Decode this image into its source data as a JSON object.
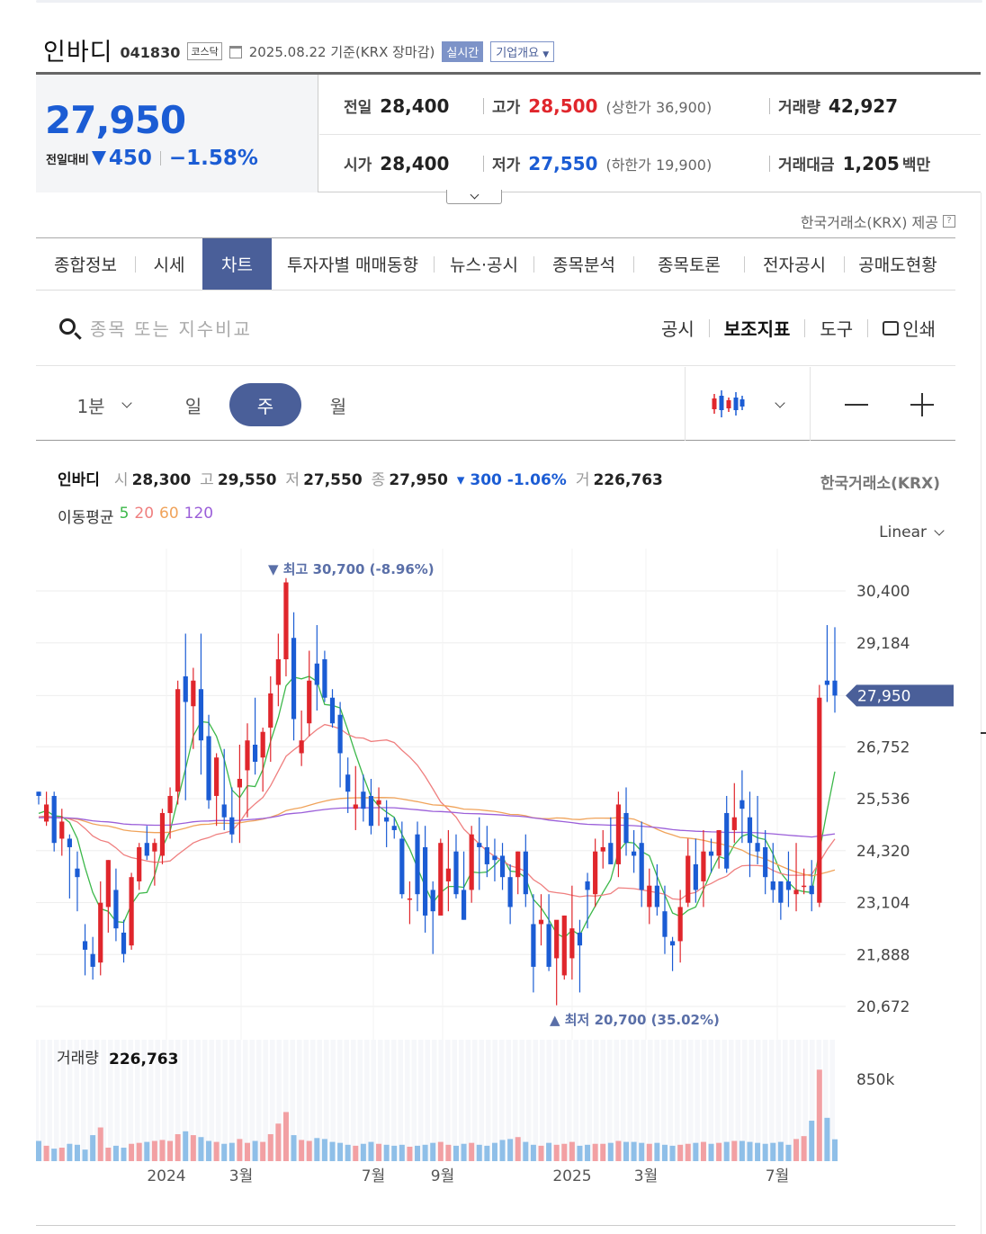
{
  "header": {
    "stock_name": "인바디",
    "stock_code": "041830",
    "market_badge": "코스닥",
    "date_text": "2025.08.22 기준(KRX 장마감)",
    "realtime_badge": "실시간",
    "company_btn": "기업개요"
  },
  "quote": {
    "price": "27,950",
    "change_label": "전일대비",
    "change_value": "450",
    "change_pct": "−1.58%",
    "prev_label": "전일",
    "prev_value": "28,400",
    "high_label": "고가",
    "high_value": "28,500",
    "upper_limit": "(상한가 36,900)",
    "volume_label": "거래량",
    "volume_value": "42,927",
    "open_label": "시가",
    "open_value": "28,400",
    "low_label": "저가",
    "low_value": "27,550",
    "lower_limit": "(하한가 19,900)",
    "amount_label": "거래대금",
    "amount_value": "1,205",
    "amount_unit": "백만"
  },
  "provider_note": "한국거래소(KRX) 제공",
  "tabs": [
    "종합정보",
    "시세",
    "차트",
    "투자자별 매매동향",
    "뉴스·공시",
    "종목분석",
    "종목토론",
    "전자공시",
    "공매도현황"
  ],
  "search": {
    "placeholder": "종목 또는 지수비교"
  },
  "tools": {
    "notice": "공시",
    "indicator": "보조지표",
    "tool": "도구",
    "print": "인쇄"
  },
  "periods": {
    "minute": "1분",
    "day": "일",
    "week": "주",
    "month": "월"
  },
  "chart_info": {
    "name": "인바디",
    "open_k": "시",
    "open_v": "28,300",
    "high_k": "고",
    "high_v": "29,550",
    "low_k": "저",
    "low_v": "27,550",
    "close_k": "종",
    "close_v": "27,950",
    "change": "▾ 300 -1.06%",
    "vol_k": "거",
    "vol_v": "226,763",
    "exchange": "한국거래소(KRX)",
    "ma_label": "이동평균",
    "ma_5": "5",
    "ma_20": "20",
    "ma_60": "60",
    "ma_120": "120",
    "scale": "Linear"
  },
  "colors": {
    "up": "#e0262c",
    "down": "#1b5cd4",
    "accent": "#4a5f99",
    "ma5": "#3cb84a",
    "ma20": "#ef7f7f",
    "ma60": "#f0a35a",
    "ma120": "#9b5fd9"
  },
  "chart_data": {
    "type": "candlestick",
    "timeframe": "weekly",
    "y_ticks": [
      "30,400",
      "29,184",
      "27,950",
      "26,752",
      "25,536",
      "24,320",
      "23,104",
      "21,888",
      "20,672"
    ],
    "ylim": [
      20672,
      30400
    ],
    "x_ticks": [
      "2024",
      "3월",
      "7월",
      "9월",
      "2025",
      "3월",
      "7월"
    ],
    "current_price": "27,950",
    "max_annotation": "▼ 최고 30,700 (-8.96%)",
    "min_annotation": "▲ 최저 20,700 (35.02%)",
    "volume_label": "거래량",
    "volume_value": "226,763",
    "volume_tick": "850k",
    "candles": [
      [
        25700,
        25700,
        25400,
        25600
      ],
      [
        25000,
        25700,
        24900,
        25400
      ],
      [
        25600,
        25700,
        24300,
        24500
      ],
      [
        24600,
        25300,
        24200,
        25000
      ],
      [
        24600,
        24700,
        23200,
        24400
      ],
      [
        23900,
        24300,
        22900,
        23700
      ],
      [
        22200,
        22600,
        21400,
        22000
      ],
      [
        21900,
        22300,
        21300,
        21600
      ],
      [
        21700,
        23600,
        21400,
        23100
      ],
      [
        23000,
        24100,
        22400,
        24100
      ],
      [
        23400,
        23900,
        22200,
        22500
      ],
      [
        22400,
        22700,
        21700,
        21900
      ],
      [
        22100,
        23800,
        22000,
        23700
      ],
      [
        23600,
        24500,
        23400,
        24400
      ],
      [
        24500,
        24900,
        24100,
        24200
      ],
      [
        24300,
        24600,
        23500,
        24500
      ],
      [
        24200,
        25300,
        24000,
        25200
      ],
      [
        25200,
        25800,
        24600,
        25600
      ],
      [
        25700,
        28300,
        25400,
        28100
      ],
      [
        28400,
        29400,
        25500,
        27800
      ],
      [
        27700,
        28600,
        26700,
        28300
      ],
      [
        28100,
        29400,
        26100,
        26900
      ],
      [
        27000,
        27500,
        25300,
        25500
      ],
      [
        25600,
        26600,
        24900,
        26500
      ],
      [
        25400,
        26700,
        24800,
        25100
      ],
      [
        25100,
        25800,
        24500,
        24700
      ],
      [
        25800,
        26800,
        24500,
        26000
      ],
      [
        26200,
        27300,
        25100,
        26900
      ],
      [
        26800,
        27900,
        26100,
        26400
      ],
      [
        26500,
        27200,
        25700,
        27100
      ],
      [
        27200,
        28400,
        26400,
        28000
      ],
      [
        28200,
        29400,
        27700,
        28800
      ],
      [
        28800,
        30700,
        28400,
        30600
      ],
      [
        29300,
        29900,
        26900,
        27400
      ],
      [
        26600,
        27600,
        26300,
        26900
      ],
      [
        27300,
        29000,
        27000,
        28300
      ],
      [
        28700,
        29600,
        27600,
        28200
      ],
      [
        28800,
        29000,
        27800,
        27900
      ],
      [
        27900,
        28100,
        27200,
        27300
      ],
      [
        27500,
        27800,
        25800,
        26600
      ],
      [
        26100,
        26500,
        25200,
        25700
      ],
      [
        25300,
        26300,
        24800,
        25400
      ],
      [
        25700,
        26100,
        25000,
        25300
      ],
      [
        25600,
        26000,
        24700,
        24900
      ],
      [
        25400,
        25800,
        24900,
        25500
      ],
      [
        25100,
        25500,
        24400,
        25000
      ],
      [
        24900,
        25100,
        24600,
        24800
      ],
      [
        24600,
        25000,
        23200,
        23300
      ],
      [
        23200,
        23600,
        22600,
        23200
      ],
      [
        24700,
        25000,
        22900,
        23300
      ],
      [
        24400,
        24900,
        22400,
        22800
      ],
      [
        23400,
        23600,
        21900,
        22900
      ],
      [
        22800,
        24600,
        23000,
        24500
      ],
      [
        23600,
        24800,
        22900,
        23900
      ],
      [
        24300,
        24700,
        23200,
        23300
      ],
      [
        23400,
        24300,
        22700,
        22700
      ],
      [
        23400,
        24900,
        23100,
        24700
      ],
      [
        24500,
        25100,
        23400,
        24400
      ],
      [
        24400,
        24900,
        23700,
        24000
      ],
      [
        24200,
        24600,
        23600,
        24100
      ],
      [
        24200,
        24500,
        23400,
        23700
      ],
      [
        23700,
        24000,
        22600,
        23000
      ],
      [
        23700,
        24300,
        23300,
        24300
      ],
      [
        24300,
        24700,
        23000,
        23300
      ],
      [
        22600,
        23300,
        21000,
        21600
      ],
      [
        22600,
        23300,
        22100,
        22700
      ],
      [
        22600,
        23300,
        21500,
        21600
      ],
      [
        21800,
        22200,
        20700,
        22700
      ],
      [
        21400,
        22800,
        21300,
        22800
      ],
      [
        21800,
        23500,
        21300,
        22500
      ],
      [
        22400,
        22700,
        21000,
        22100
      ],
      [
        23600,
        23800,
        22500,
        23400
      ],
      [
        23300,
        24600,
        23000,
        24300
      ],
      [
        24300,
        24800,
        23900,
        24400
      ],
      [
        24500,
        25100,
        24000,
        24000
      ],
      [
        24000,
        25700,
        23700,
        25400
      ],
      [
        25200,
        25800,
        24200,
        24500
      ],
      [
        24300,
        24800,
        23800,
        24200
      ],
      [
        24500,
        25000,
        23000,
        23400
      ],
      [
        23000,
        23900,
        22600,
        23500
      ],
      [
        23500,
        24000,
        22800,
        23000
      ],
      [
        22900,
        23500,
        21900,
        22300
      ],
      [
        22200,
        22300,
        21500,
        22100
      ],
      [
        22200,
        23400,
        21700,
        23000
      ],
      [
        23100,
        24600,
        23000,
        24200
      ],
      [
        24000,
        24600,
        23100,
        23400
      ],
      [
        23600,
        24800,
        23000,
        24300
      ],
      [
        24300,
        24600,
        23800,
        24200
      ],
      [
        24200,
        24800,
        23900,
        24800
      ],
      [
        25200,
        25600,
        23800,
        23900
      ],
      [
        24800,
        25900,
        24500,
        25100
      ],
      [
        25500,
        26200,
        24500,
        25300
      ],
      [
        25100,
        25700,
        23700,
        24500
      ],
      [
        24500,
        25600,
        24000,
        24300
      ],
      [
        24400,
        24800,
        23300,
        23700
      ],
      [
        23600,
        24500,
        23100,
        23400
      ],
      [
        23600,
        23600,
        22700,
        23100
      ],
      [
        23600,
        24300,
        23000,
        23400
      ],
      [
        23300,
        24500,
        22900,
        23400
      ],
      [
        23500,
        23900,
        23300,
        23500
      ],
      [
        23500,
        24100,
        22900,
        23300
      ],
      [
        23100,
        28200,
        23000,
        27900
      ],
      [
        28300,
        29600,
        27800,
        28200
      ],
      [
        28300,
        29550,
        27550,
        27950
      ]
    ],
    "volumes": [
      210,
      160,
      130,
      140,
      180,
      170,
      120,
      270,
      350,
      140,
      160,
      140,
      180,
      190,
      200,
      210,
      220,
      210,
      280,
      310,
      270,
      250,
      210,
      200,
      180,
      190,
      230,
      190,
      210,
      200,
      280,
      390,
      510,
      270,
      220,
      210,
      240,
      230,
      200,
      190,
      170,
      160,
      180,
      200,
      180,
      170,
      160,
      170,
      150,
      160,
      170,
      190,
      200,
      170,
      160,
      180,
      190,
      170,
      160,
      190,
      220,
      230,
      250,
      200,
      170,
      160,
      190,
      170,
      180,
      200,
      160,
      170,
      180,
      180,
      190,
      210,
      200,
      200,
      190,
      180,
      190,
      170,
      160,
      170,
      180,
      190,
      200,
      180,
      190,
      200,
      210,
      210,
      200,
      190,
      180,
      190,
      200,
      170,
      230,
      260,
      420,
      950,
      450,
      227
    ],
    "ma": [
      {
        "name": "5",
        "color": "#3cb84a"
      },
      {
        "name": "20",
        "color": "#ef7f7f"
      },
      {
        "name": "60",
        "color": "#f0a35a"
      },
      {
        "name": "120",
        "color": "#9b5fd9"
      }
    ]
  }
}
